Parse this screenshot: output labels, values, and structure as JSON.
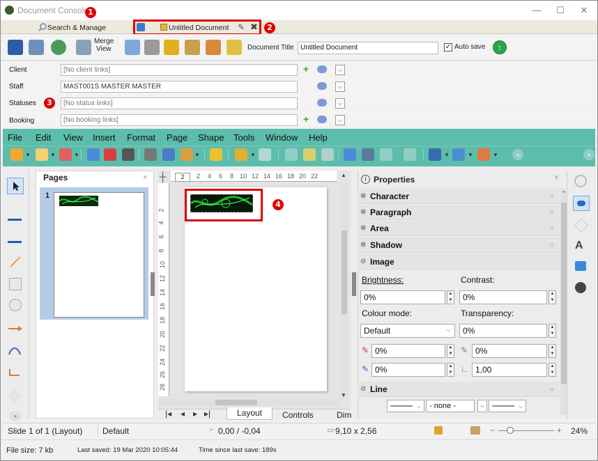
{
  "window": {
    "title": "Document Console",
    "controls": {
      "minimize": "—",
      "maximize": "☐",
      "close": "✕"
    }
  },
  "tabs": {
    "search_manage": "Search & Manage",
    "untitled_doc": "Untitled Document"
  },
  "toolbar": {
    "merge_view": "Merge\nView",
    "merge_view_line1": "Merge",
    "merge_view_line2": "View",
    "document_title_label": "Document Title",
    "document_title_value": "Untitled Document",
    "auto_save_label": "Auto save",
    "auto_save_checked": true
  },
  "fields": {
    "client": {
      "label": "Client",
      "value": "[No client links]"
    },
    "staff": {
      "label": "Staff",
      "value": "MAST001S MASTER MASTER"
    },
    "statuses": {
      "label": "Statuses",
      "value": "[No status links]"
    },
    "booking": {
      "label": "Booking",
      "value": "[No booking links]"
    }
  },
  "menu": [
    "File",
    "Edit",
    "View",
    "Insert",
    "Format",
    "Page",
    "Shape",
    "Tools",
    "Window",
    "Help"
  ],
  "pages_panel": {
    "title": "Pages",
    "page_number": "1",
    "close": "×"
  },
  "ruler": {
    "h_ticks": [
      "2",
      "2",
      "4",
      "6",
      "8",
      "10",
      "12",
      "14",
      "16",
      "18",
      "20",
      "22"
    ],
    "v_ticks": [
      "2",
      "4",
      "6",
      "8",
      "10",
      "12",
      "14",
      "16",
      "18",
      "20",
      "22",
      "24",
      "26",
      "28"
    ]
  },
  "doc_tabs": {
    "layout": "Layout",
    "controls": "Controls",
    "dimension": "Dim"
  },
  "properties": {
    "title": "Properties",
    "sections": {
      "character": "Character",
      "paragraph": "Paragraph",
      "area": "Area",
      "shadow": "Shadow",
      "image": "Image",
      "line": "Line"
    },
    "brightness_label": "Brightness:",
    "brightness_value": "0%",
    "contrast_label": "Contrast:",
    "contrast_value": "0%",
    "colour_mode_label": "Colour mode:",
    "colour_mode_value": "Default",
    "transparency_label": "Transparency:",
    "transparency_value": "0%",
    "red_value": "0%",
    "green_value": "0%",
    "blue_value": "0%",
    "gamma_value": "1,00",
    "line_none": "- none -"
  },
  "statusbar": {
    "slide": "Slide 1 of 1 (Layout)",
    "master": "Default",
    "position": "0,00 / -0,04",
    "size": "9,10 x 2,56",
    "zoom_minus": "−",
    "zoom_plus": "+",
    "zoom": "24%"
  },
  "footer": {
    "file_size": "File size: 7 kb",
    "last_saved": "Last saved: 19 Mar 2020 10:05:44",
    "since_save": "Time since last save: 189s"
  },
  "annotations": [
    "1",
    "2",
    "3",
    "4"
  ],
  "colors": {
    "accent_teal": "#5dbdac",
    "annotation_red": "#e00000"
  }
}
